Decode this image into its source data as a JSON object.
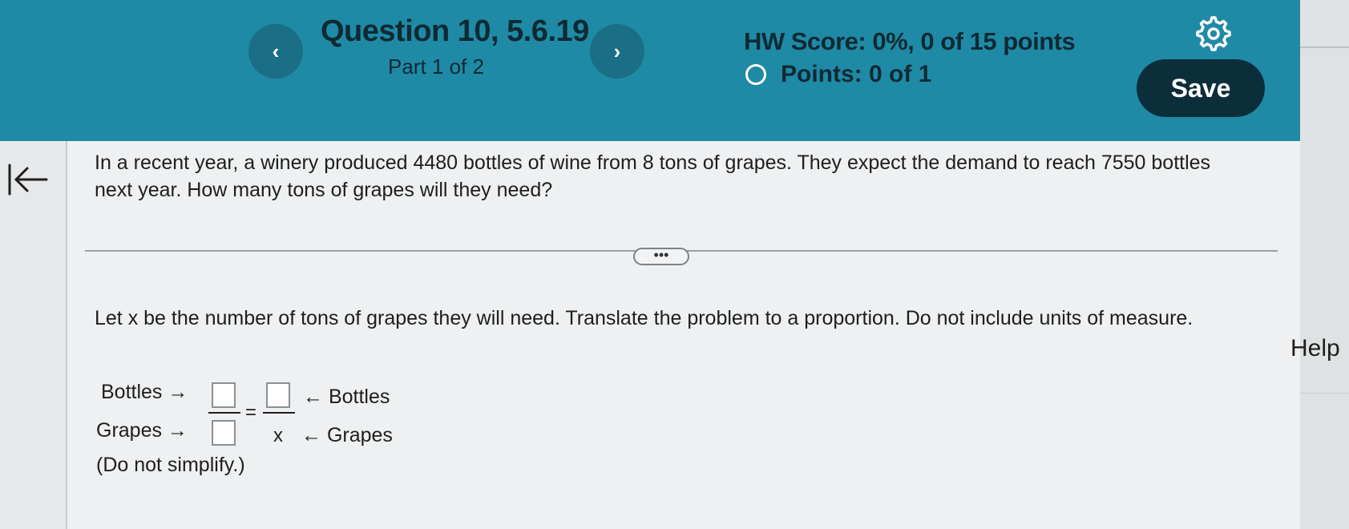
{
  "header": {
    "question_title": "Question 10, 5.6.19",
    "part": "Part 1 of 2",
    "hw_score": "HW Score: 0%, 0 of 15 points",
    "points": "Points: 0 of 1",
    "save_label": "Save",
    "prev_label": "‹",
    "next_label": "›"
  },
  "problem": {
    "text": "In a recent year, a winery produced 4480 bottles of wine from 8 tons of grapes. They expect the demand to reach 7550 bottles next year. How many tons of grapes will they need?"
  },
  "more_label": "•••",
  "instructions": "Let x be the number of tons of grapes they will need. Translate the problem to a proportion. Do not include units of measure.",
  "proportion": {
    "left_top_label": "Bottles →",
    "left_bottom_label": "Grapes →",
    "equals": "=",
    "x_var": "x",
    "right_top_label": "← Bottles",
    "right_bottom_label": "← Grapes",
    "note": "(Do not simplify.)"
  },
  "help_label": "Help",
  "icons": [
    "chevron-left-icon",
    "chevron-right-icon",
    "gear-icon",
    "radio-circle-icon",
    "collapse-left-icon"
  ],
  "colors": {
    "header_bg": "#1f8aa6",
    "save_bg": "#0c2e3a",
    "nav_btn_bg": "#1a6e85"
  }
}
